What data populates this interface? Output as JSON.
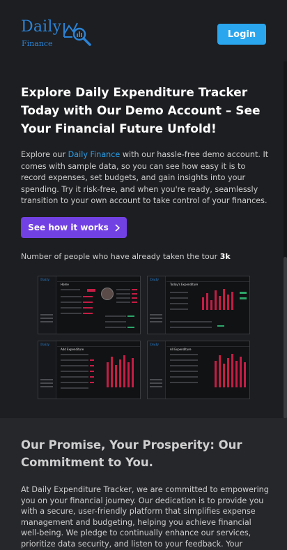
{
  "header": {
    "logo_word": "Daily",
    "logo_sub": "Finance",
    "login_label": "Login"
  },
  "hero": {
    "title": "Explore Daily Expenditure Tracker Today with Our Demo Account – See Your Financial Future Unfold!",
    "body_pre": "Explore our ",
    "body_link": "Daily Finance",
    "body_post": " with our hassle-free demo account. It comes with sample data, so you can see how easy it is to record expenses, set budgets, and gain insights into your spending. Try it risk-free, and when you're ready, seamlessly transition to your own account to take control of your finances.",
    "cta_label": "See how it works",
    "tour_text": "Number of people who have already taken the tour ",
    "tour_count": "3k"
  },
  "screenshots": [
    {
      "title": "Home"
    },
    {
      "title": "Today's Expenditure"
    },
    {
      "title": "Add Expenditure"
    },
    {
      "title": "All Expenditure"
    }
  ],
  "promise": {
    "title": "Our Promise, Your Prosperity: Our Commitment to You.",
    "body": "At Daily Expenditure Tracker, we are committed to empowering you on your financial journey. Our dedication is to provide you with a secure, user-friendly platform that simplifies expense management and budgeting, helping you achieve financial well-being. We pledge to continually enhance our services, prioritize data security, and listen to your feedback. Your"
  },
  "colors": {
    "brand_blue": "#2b83d6",
    "login_blue": "#2aa6ef",
    "cta_purple": "#7241e3",
    "chart_red": "#c51d45"
  }
}
